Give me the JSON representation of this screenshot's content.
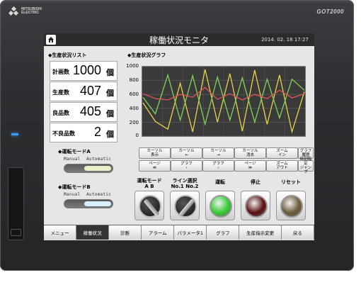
{
  "device": {
    "brand": "MITSUBISHI\nELECTRIC",
    "model": "GOT2000"
  },
  "header": {
    "title": "稼働状況モニタ",
    "datetime": "2014. 02. 18  17:27",
    "home_icon": "home-icon"
  },
  "production": {
    "title": "◆生産状況リスト",
    "rows": [
      {
        "label": "計画数",
        "value": "1000",
        "unit": "個"
      },
      {
        "label": "生産数",
        "value": "407",
        "unit": "個"
      },
      {
        "label": "良品数",
        "value": "405",
        "unit": "個"
      },
      {
        "label": "不良品数",
        "value": "2",
        "unit": "個"
      }
    ]
  },
  "graph": {
    "title": "◆生産状況グラフ",
    "buttons": [
      "カーソル\n表示",
      "カーソル\n←",
      "カーソル\n→",
      "カーソル\n消去",
      "ズーム\nイン",
      "グラフ\n履歴",
      "ページ\n≪",
      "グラフ\n‹",
      "グラフ\n›",
      "ページ\n≫",
      "ズーム\nアウト",
      "時刻指定\nジャンプ"
    ]
  },
  "chart_data": {
    "type": "line",
    "ylim": [
      0,
      1000
    ],
    "yticks": [
      "1000",
      "800",
      "600",
      "400",
      "200",
      "0"
    ],
    "grid": true,
    "series": [
      {
        "color": "#e8d44a",
        "values": [
          480,
          210,
          100,
          760,
          60,
          960,
          200,
          900,
          70,
          950,
          170,
          880,
          60,
          640
        ]
      },
      {
        "color": "#7fd35a",
        "values": [
          560,
          320,
          880,
          230,
          870,
          170,
          850,
          230,
          840,
          200,
          820,
          260,
          820,
          660
        ]
      },
      {
        "color": "#e05555",
        "values": [
          610,
          540,
          520,
          600,
          560,
          700,
          530,
          610,
          520,
          600,
          540,
          660,
          550,
          610
        ]
      }
    ]
  },
  "modes": [
    {
      "title": "◆運転モードA",
      "manual": "Manual",
      "auto": "Automatic",
      "knob_color": "#e8f0c8"
    },
    {
      "title": "◆運転モードB",
      "manual": "Manual",
      "auto": "Automatic",
      "knob_color": "#d8f0ff"
    }
  ],
  "controls": {
    "mode_selector_label": "運転モード\nA      B",
    "line_select_label": "ライン選択\nNo.1  No.2",
    "run_label": "運転",
    "stop_label": "停止",
    "reset_label": "リセット",
    "run_color": "#33cc33",
    "stop_color": "#5a0f0f",
    "reset_color": "#6b5a3a"
  },
  "nav": [
    "メニュー",
    "稼働状況",
    "診断",
    "アラーム",
    "パラメータ1",
    "グラフ",
    "生産指示変更",
    "戻る"
  ],
  "nav_active": 1
}
